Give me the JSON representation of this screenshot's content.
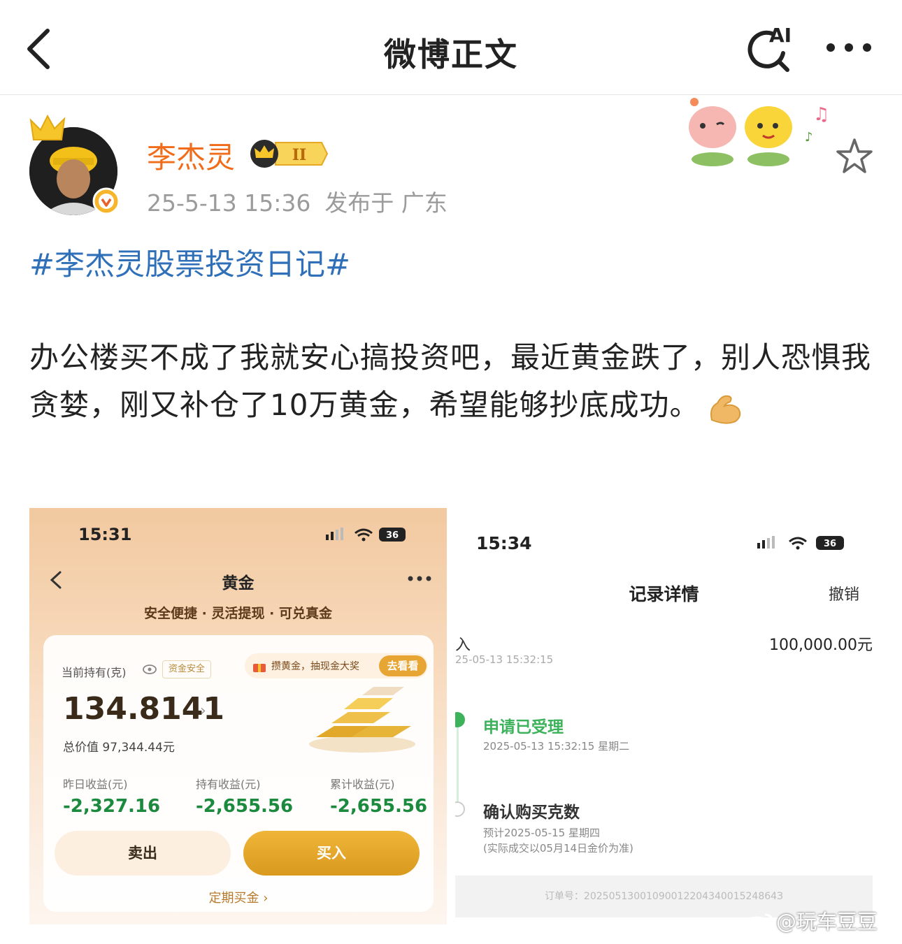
{
  "nav": {
    "title": "微博正文",
    "ai_label": "AI"
  },
  "post": {
    "username": "李杰灵",
    "vip_level": "II",
    "timestamp": "25-5-13 15:36",
    "location": "发布于 广东",
    "hashtag": "#李杰灵股票投资日记#",
    "text": "办公楼买不成了我就安心搞投资吧，最近黄金跌了，别人恐惧我贪婪，刚又补仓了10万黄金，希望能够抄底成功。",
    "emoji": "flexed-biceps"
  },
  "screenshot1": {
    "time": "15:31",
    "battery": "36",
    "title": "黄金",
    "slogan": "安全便捷 · 灵活提现 · 可兑真金",
    "hold_label": "当前持有(克)",
    "safe_badge": "资金安全",
    "promo_text": "攒黄金，抽现金大奖",
    "promo_button": "去看看",
    "amount": "134.8141",
    "total_value": "总价值 97,344.44元",
    "stats": [
      {
        "label": "昨日收益(元)",
        "value": "-2,327.16"
      },
      {
        "label": "持有收益(元)",
        "value": "-2,655.56"
      },
      {
        "label": "累计收益(元)",
        "value": "-2,655.56"
      }
    ],
    "sell_label": "卖出",
    "buy_label": "买入",
    "regular_label": "定期买金 ›"
  },
  "screenshot2": {
    "time": "15:34",
    "battery": "36",
    "title": "记录详情",
    "cancel_label": "撤销",
    "row_label": "入",
    "row_amount": "100,000.00元",
    "row_date": "25-05-13 15:32:15",
    "step1_title": "申请已受理",
    "step1_date": "2025-05-13 15:32:15 星期二",
    "step2_title": "确认购买克数",
    "step2_estimate": "预计2025-05-15 星期四",
    "step2_note": "(实际成交以05月14日金价为准)",
    "order_no": "订单号：2025051300109001220434001524864З"
  },
  "watermark": "@玩车豆豆",
  "colors": {
    "username": "#f06c1a",
    "hashtag": "#2f70b8",
    "loss_green": "#1c8a3e",
    "buy_gold": "#e0a42a",
    "step_green": "#3cb25b"
  }
}
